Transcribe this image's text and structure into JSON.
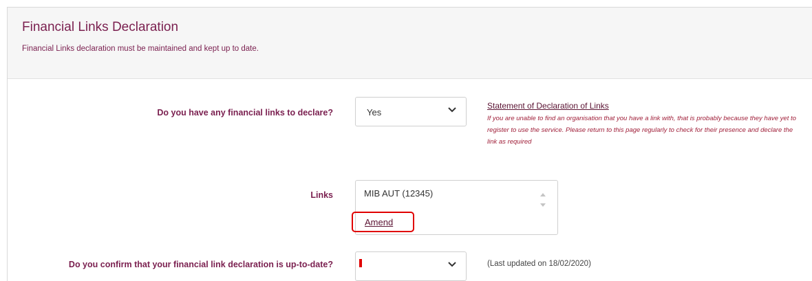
{
  "header": {
    "title": "Financial Links Declaration",
    "subtitle": "Financial Links declaration must be maintained and kept up to date."
  },
  "q_links": {
    "label": "Do you have any financial links to declare?",
    "selected": "Yes"
  },
  "statement": {
    "title": "Statement of Declaration of Links",
    "text": "If you are unable to find an organisation that you have a link with, that is probably because they have yet to register to use the service. Please return to this page regularly to check for their presence and declare the link as required"
  },
  "links": {
    "label": "Links",
    "items": [
      "MIB AUT (12345)"
    ],
    "amend_label": "Amend"
  },
  "q_confirm": {
    "label": "Do you confirm that your financial link declaration is up-to-date?",
    "selected": "",
    "last_updated": "(Last updated on 18/02/2020)"
  },
  "colors": {
    "accent": "#7a1f4f",
    "highlight": "#e00000"
  }
}
